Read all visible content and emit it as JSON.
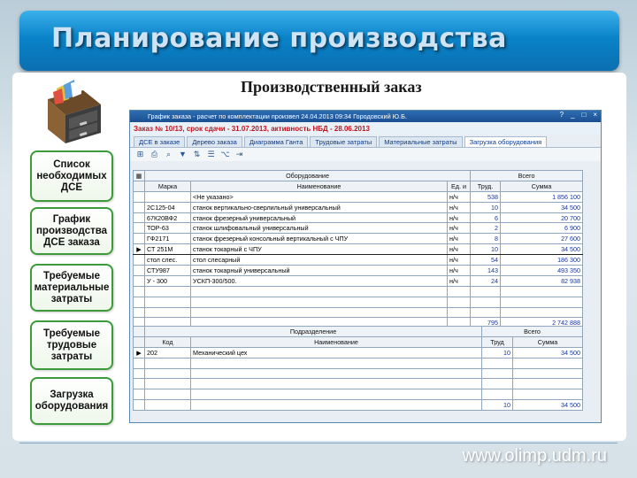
{
  "header": {
    "title": "Планирование производства"
  },
  "subtitle": "Производственный заказ",
  "nav": [
    {
      "label": "Список необходимых ДСЕ"
    },
    {
      "label": "График производства ДСЕ заказа"
    },
    {
      "label": "Требуемые материальные затраты"
    },
    {
      "label": "Требуемые трудовые затраты"
    },
    {
      "label": "Загрузка оборудования"
    }
  ],
  "window": {
    "title": "График заказа - расчет по комплектации произвел 24.04.2013 09:34 Городовский Ю.Б.",
    "controls": [
      "?",
      "_",
      "□",
      "×"
    ],
    "order_line": "Заказ № 10/13,   срок сдачи - 31.07.2013,   активность НБД - 28.06.2013",
    "tabs": [
      "ДСЕ в заказе",
      "Дерево заказа",
      "Диаграмма Ганта",
      "Трудовые затраты",
      "Материальные затраты",
      "Загрузка оборудования"
    ],
    "active_tab": 5,
    "toolbar_icons": [
      "add-icon",
      "print-icon",
      "search-icon",
      "filter-icon",
      "sort-icon",
      "list-icon",
      "tree-icon",
      "exit-icon"
    ]
  },
  "equipment_table": {
    "group_headers": {
      "equipment": "Оборудование",
      "total": "Всего"
    },
    "columns": [
      "Марка",
      "Наименование",
      "Ед. и",
      "Труд.",
      "Сумма"
    ],
    "rows": [
      {
        "mark": "",
        "brand": "",
        "name": "<Не указано>",
        "unit": "н/ч",
        "labor": "538",
        "sum": "1 856 100"
      },
      {
        "mark": "",
        "brand": "2С125-04",
        "name": "станок  вертикально-сверлильный универсальный",
        "unit": "н/ч",
        "labor": "10",
        "sum": "34 500"
      },
      {
        "mark": "",
        "brand": "67К20ВФ2",
        "name": "станок фрезерный универсальный",
        "unit": "н/ч",
        "labor": "6",
        "sum": "20 700"
      },
      {
        "mark": "",
        "brand": "ТОР-63",
        "name": "станок шлифовальный универсальный",
        "unit": "н/ч",
        "labor": "2",
        "sum": "6 900"
      },
      {
        "mark": "",
        "brand": "ГФ2171",
        "name": "станок фрезерный консольный вертикальный с ЧПУ",
        "unit": "н/ч",
        "labor": "8",
        "sum": "27 600"
      },
      {
        "mark": "▶",
        "brand": "СТ 251М",
        "name": "станок токарный  с ЧПУ",
        "unit": "н/ч",
        "labor": "10",
        "sum": "34 500"
      },
      {
        "mark": "",
        "brand": "стол слес.",
        "name": "стол слесарный",
        "unit": "н/ч",
        "labor": "54",
        "sum": "186 300"
      },
      {
        "mark": "",
        "brand": "СТУ987",
        "name": "станок токарный универсальный",
        "unit": "н/ч",
        "labor": "143",
        "sum": "493 350"
      },
      {
        "mark": "",
        "brand": "У - 300",
        "name": "УСКП-300/500.",
        "unit": "н/ч",
        "labor": "24",
        "sum": "82 938"
      }
    ],
    "totals": {
      "labor": "795",
      "sum": "2 742 888"
    }
  },
  "department_table": {
    "group_headers": {
      "department": "Подразделение",
      "total": "Всего"
    },
    "columns": [
      "Код",
      "Наименование",
      "Труд",
      "Сумма"
    ],
    "rows": [
      {
        "mark": "▶",
        "code": "202",
        "name": "Механический цех",
        "labor": "10",
        "sum": "34 500"
      }
    ],
    "totals": {
      "labor": "10",
      "sum": "34 500"
    }
  },
  "footer": {
    "url": "www.olimp.udm.ru"
  },
  "colors": {
    "header_blue": "#0a83c9",
    "nav_border": "#3e9a3a",
    "order_red": "#c0141c",
    "value_blue": "#1636a8"
  }
}
